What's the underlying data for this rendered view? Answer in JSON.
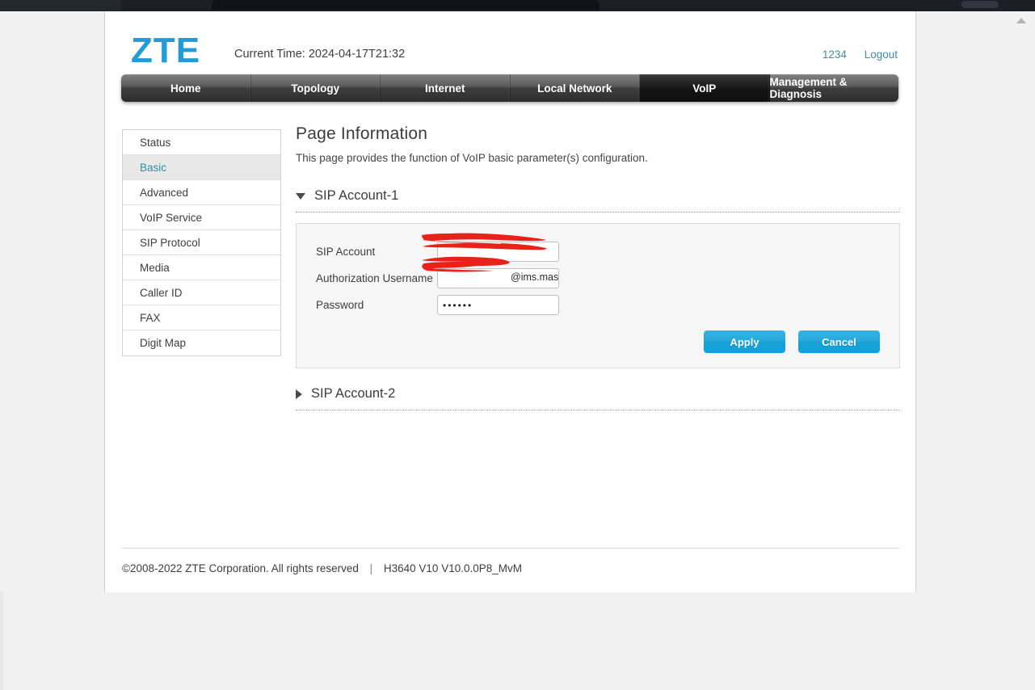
{
  "browser": {
    "scroll_up_icon": "scroll-up-arrow-icon"
  },
  "header": {
    "logo_text": "ZTE",
    "current_time": "Current Time: 2024-04-17T21:32",
    "user_link": "1234",
    "logout_link": "Logout"
  },
  "nav": {
    "items": [
      {
        "label": "Home",
        "active": false
      },
      {
        "label": "Topology",
        "active": false
      },
      {
        "label": "Internet",
        "active": false
      },
      {
        "label": "Local Network",
        "active": false
      },
      {
        "label": "VoIP",
        "active": true
      },
      {
        "label": "Management & Diagnosis",
        "active": false
      }
    ]
  },
  "sidebar": {
    "items": [
      {
        "label": "Status",
        "active": false
      },
      {
        "label": "Basic",
        "active": true
      },
      {
        "label": "Advanced",
        "active": false
      },
      {
        "label": "VoIP Service",
        "active": false
      },
      {
        "label": "SIP Protocol",
        "active": false
      },
      {
        "label": "Media",
        "active": false
      },
      {
        "label": "Caller ID",
        "active": false
      },
      {
        "label": "FAX",
        "active": false
      },
      {
        "label": "Digit Map",
        "active": false
      }
    ]
  },
  "main": {
    "title": "Page Information",
    "description": "This page provides the function of VoIP basic parameter(s) configuration.",
    "sections": [
      {
        "label": "SIP Account-1",
        "expanded": true,
        "toggle_icon": "triangle-down-icon"
      },
      {
        "label": "SIP Account-2",
        "expanded": false,
        "toggle_icon": "triangle-right-icon"
      }
    ],
    "form": {
      "fields": [
        {
          "label": "SIP Account",
          "value": "",
          "redacted": true,
          "placeholder": ""
        },
        {
          "label": "Authorization Username",
          "value": "@ims.mas",
          "redacted": true,
          "placeholder": ""
        },
        {
          "label": "Password",
          "value": "••••••",
          "redacted": false,
          "placeholder": ""
        }
      ],
      "apply_label": "Apply",
      "cancel_label": "Cancel"
    }
  },
  "footer": {
    "copyright": "©2008-2022 ZTE Corporation. All rights reserved",
    "separator": "|",
    "model": "H3640 V10 V10.0.0P8_MvM"
  },
  "colors": {
    "brand_blue": "#229bd8",
    "link_teal": "#3d8fa6",
    "button_blue": "#17a0d6",
    "redaction_red": "#e8211a",
    "nav_active": "#141414"
  }
}
